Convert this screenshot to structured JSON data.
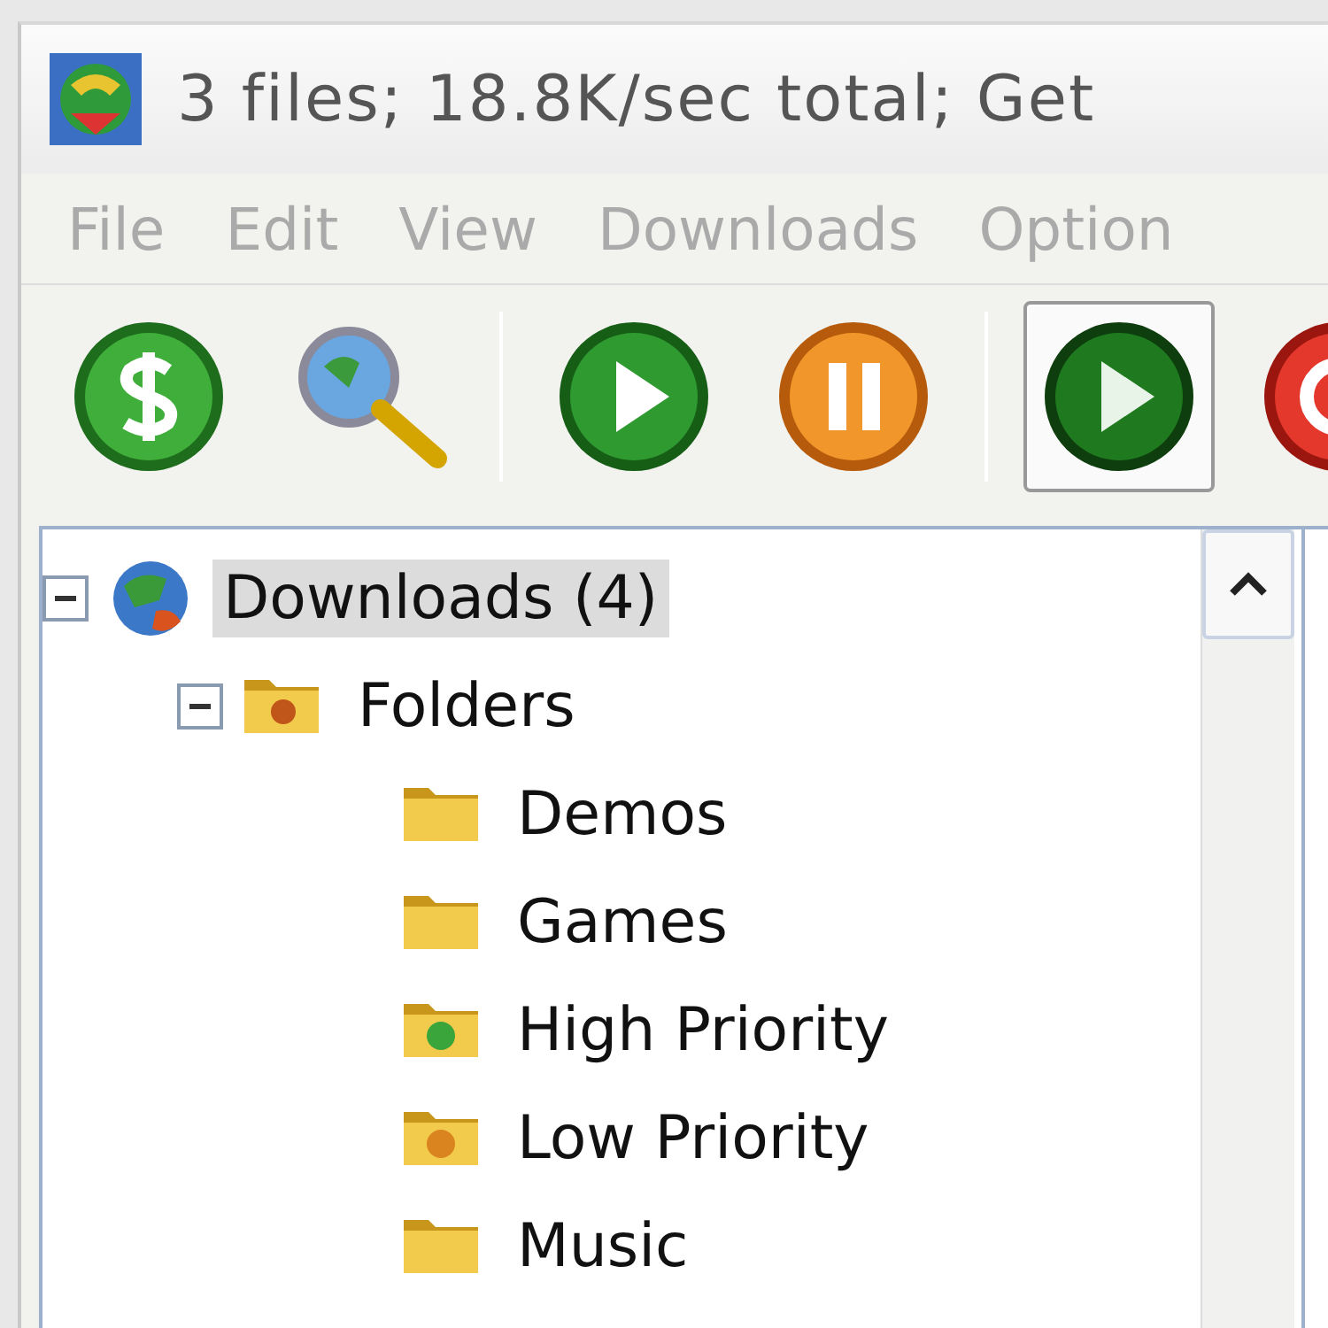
{
  "window": {
    "title": "3 files; 18.8K/sec total; Get"
  },
  "menu": [
    {
      "label": "File",
      "disabled": true
    },
    {
      "label": "Edit",
      "disabled": true
    },
    {
      "label": "View",
      "disabled": true
    },
    {
      "label": "Downloads",
      "disabled": true
    },
    {
      "label": "Option",
      "disabled": true
    }
  ],
  "toolbar": [
    {
      "kind": "dollar",
      "pressed": false
    },
    {
      "kind": "search",
      "pressed": false
    },
    {
      "kind": "separator"
    },
    {
      "kind": "play",
      "pressed": false
    },
    {
      "kind": "pause",
      "pressed": false
    },
    {
      "kind": "separator"
    },
    {
      "kind": "play-dark",
      "pressed": true
    },
    {
      "kind": "stop",
      "pressed": false
    }
  ],
  "tree": [
    {
      "label": "Downloads (4)",
      "kind": "globe",
      "selected": true,
      "expanded": true,
      "children": [
        {
          "label": "Folders",
          "kind": "folder-open",
          "selected": false,
          "expanded": true,
          "children": [
            {
              "label": "Demos",
              "kind": "folder",
              "selected": false
            },
            {
              "label": "Games",
              "kind": "folder",
              "selected": false
            },
            {
              "label": "High Priority",
              "kind": "folder-up",
              "selected": false
            },
            {
              "label": "Low Priority",
              "kind": "folder-down",
              "selected": false
            },
            {
              "label": "Music",
              "kind": "folder",
              "selected": false
            }
          ]
        }
      ]
    }
  ]
}
